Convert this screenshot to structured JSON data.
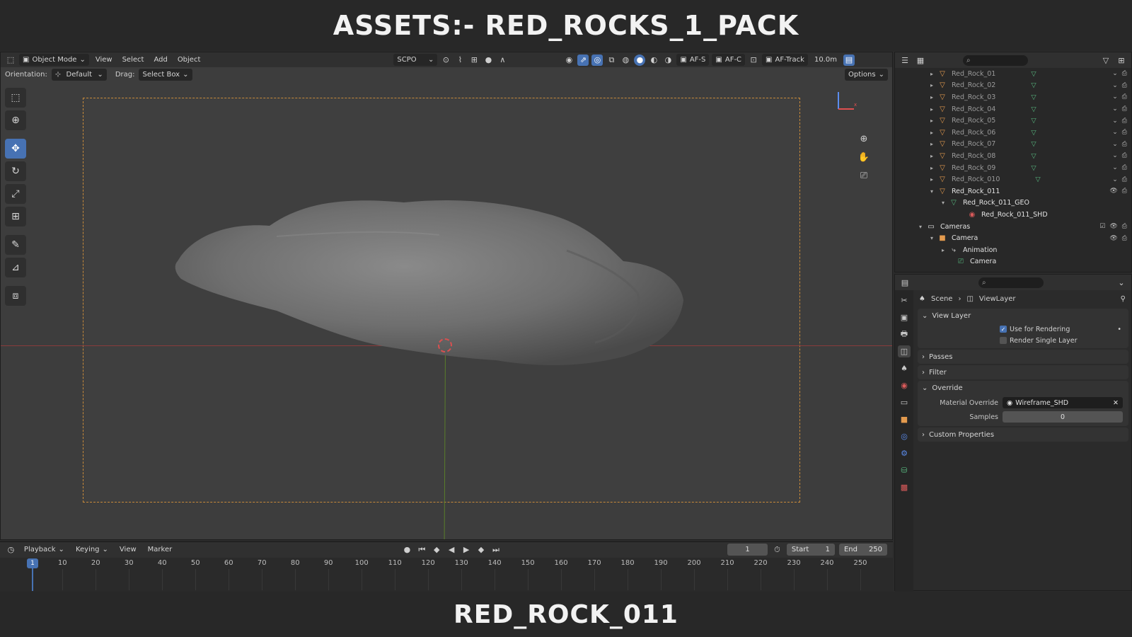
{
  "top_title": "ASSETS:- RED_ROCKS_1_PACK",
  "bottom_title": "RED_ROCK_011",
  "viewport": {
    "mode": "Object Mode",
    "menu": [
      "View",
      "Select",
      "Add",
      "Object"
    ],
    "scpo": "SCPO",
    "af_s": "AF-S",
    "af_c": "AF-C",
    "af_track": "AF-Track",
    "distance": "10.0m",
    "orientation_label": "Orientation:",
    "orientation_value": "Default",
    "drag_label": "Drag:",
    "drag_value": "Select Box",
    "options": "Options"
  },
  "timeline": {
    "menu": [
      "Playback",
      "Keying",
      "View",
      "Marker"
    ],
    "current_frame": "1",
    "start_label": "Start",
    "start_value": "1",
    "end_label": "End",
    "end_value": "250",
    "ticks": [
      "1",
      "10",
      "20",
      "30",
      "40",
      "50",
      "60",
      "70",
      "80",
      "90",
      "100",
      "110",
      "120",
      "130",
      "140",
      "150",
      "160",
      "170",
      "180",
      "190",
      "200",
      "210",
      "220",
      "230",
      "240",
      "250"
    ]
  },
  "outliner": {
    "rows": [
      {
        "label": "Red_Rock_01"
      },
      {
        "label": "Red_Rock_02"
      },
      {
        "label": "Red_Rock_03"
      },
      {
        "label": "Red_Rock_04"
      },
      {
        "label": "Red_Rock_05"
      },
      {
        "label": "Red_Rock_06"
      },
      {
        "label": "Red_Rock_07"
      },
      {
        "label": "Red_Rock_08"
      },
      {
        "label": "Red_Rock_09"
      },
      {
        "label": "Red_Rock_010"
      },
      {
        "label": "Red_Rock_011"
      },
      {
        "label": "Red_Rock_011_GEO"
      },
      {
        "label": "Red_Rock_011_SHD"
      },
      {
        "label": "Cameras"
      },
      {
        "label": "Camera"
      },
      {
        "label": "Animation"
      },
      {
        "label": "Camera"
      }
    ]
  },
  "properties": {
    "crumb_scene": "Scene",
    "crumb_layer": "ViewLayer",
    "view_layer": "View Layer",
    "use_for_rendering": "Use for Rendering",
    "render_single_layer": "Render Single Layer",
    "passes": "Passes",
    "filter": "Filter",
    "override": "Override",
    "material_override_label": "Material Override",
    "material_override_value": "Wireframe_SHD",
    "samples_label": "Samples",
    "samples_value": "0",
    "custom_properties": "Custom Properties"
  },
  "colors": {
    "accent": "#4772b3",
    "object_icon": "#e39a4e",
    "mesh_icon": "#56b37c",
    "material_icon": "#d95a5a"
  }
}
